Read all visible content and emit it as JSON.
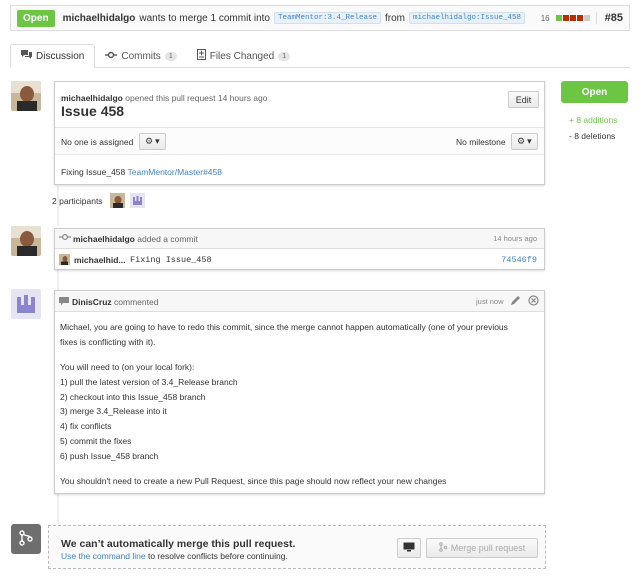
{
  "header": {
    "state": "Open",
    "author": "michaelhidalgo",
    "summary_mid": "wants to merge 1 commit into",
    "base_branch": "TeamMentor:3.4_Release",
    "from_label": "from",
    "head_branch": "michaelhidalgo:Issue_458",
    "diff_count": "16",
    "pr_number": "#85"
  },
  "tabs": [
    {
      "label": "Discussion",
      "count": ""
    },
    {
      "label": "Commits",
      "count": "1"
    },
    {
      "label": "Files Changed",
      "count": "1"
    }
  ],
  "pull": {
    "author": "michaelhidalgo",
    "opened_text": "opened this pull request 14 hours ago",
    "title": "Issue 458",
    "edit_label": "Edit",
    "assignee_text": "No one is assigned",
    "milestone_text": "No milestone",
    "body_prefix": "Fixing Issue_458",
    "body_link": "TeamMentor/Master#458"
  },
  "participants": {
    "label": "2 participants"
  },
  "sidebar": {
    "state_button": "Open",
    "additions": "+ 8 additions",
    "deletions": "- 8 deletions"
  },
  "commit_event": {
    "author": "michaelhidalgo",
    "action": "added a commit",
    "time": "14 hours ago",
    "row_author": "michaelhid...",
    "row_message": "Fixing Issue_458",
    "sha": "74546f9"
  },
  "comment": {
    "author": "DinisCruz",
    "action": "commented",
    "time": "just now",
    "paragraph1_line1": "Michael, you are going to have to redo this commit, since the merge cannot happen automatically (one of your previous",
    "paragraph1_line2": "fixes is conflicting with it).",
    "intro": "You will need to (on your local fork):",
    "steps": [
      "1) pull the latest version of 3.4_Release branch",
      "2) checkout into this Issue_458 branch",
      "3) merge 3.4_Release into it",
      "4) fix conflicts",
      "5) commit the fixes",
      "6) push Issue_458 branch"
    ],
    "closing": "You shouldn't need to create a new Pull Request, since this page should now reflect your new changes"
  },
  "merge": {
    "title": "We can’t automatically merge this pull request.",
    "hint_link": "Use the command line",
    "hint_rest": "to resolve conflicts before continuing.",
    "merge_button": "Merge pull request"
  },
  "colors": {
    "open_green": "#6cc644",
    "link_blue": "#4183c4",
    "diff_add": "#6cc644",
    "diff_del": "#bd2c00"
  }
}
